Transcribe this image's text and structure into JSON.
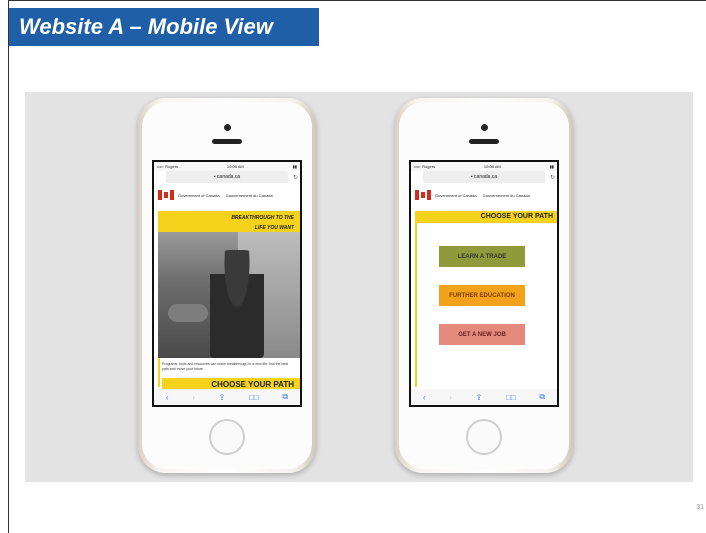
{
  "slide": {
    "title": "Website A – Mobile View",
    "page_number": "31",
    "colors": {
      "title_bg": "#1f5fa8",
      "photo_bg": "#e3e3e3"
    }
  },
  "phone_left": {
    "status": {
      "carrier": "••••◦ Rogers",
      "time": "10:08 AM",
      "battery": "▮▮"
    },
    "url": "canada.ca",
    "reload_icon": "reload-icon",
    "gov_en": "Government of Canada",
    "gov_fr": "Gouvernement du Canada",
    "headline_line1": "BREAKTHROUGH TO THE",
    "headline_line2": "LIFE YOU WANT",
    "small_copy": "Programs, tools and resources can make breakthrough to a new life, find the best path and move your future.",
    "choose_label": "CHOOSE YOUR PATH",
    "toolbar": {
      "back": "‹",
      "forward": "›",
      "share": "⇪",
      "bookmarks": "□□",
      "tabs": "⧉"
    }
  },
  "phone_right": {
    "status": {
      "carrier": "••••◦ Rogers",
      "time": "10:08 AM",
      "battery": "▮▮"
    },
    "url": "canada.ca",
    "gov_en": "Government of Canada",
    "gov_fr": "Gouvernement du Canada",
    "choose_label": "CHOOSE YOUR PATH",
    "buttons": [
      {
        "label": "LEARN A TRADE",
        "color": "#8f9b3b"
      },
      {
        "label": "FURTHER EDUCATION",
        "color": "#f3a21c"
      },
      {
        "label": "GET A NEW JOB",
        "color": "#e48a7c"
      }
    ],
    "toolbar": {
      "back": "‹",
      "forward": "›",
      "share": "⇪",
      "bookmarks": "□□",
      "tabs": "⧉"
    }
  }
}
